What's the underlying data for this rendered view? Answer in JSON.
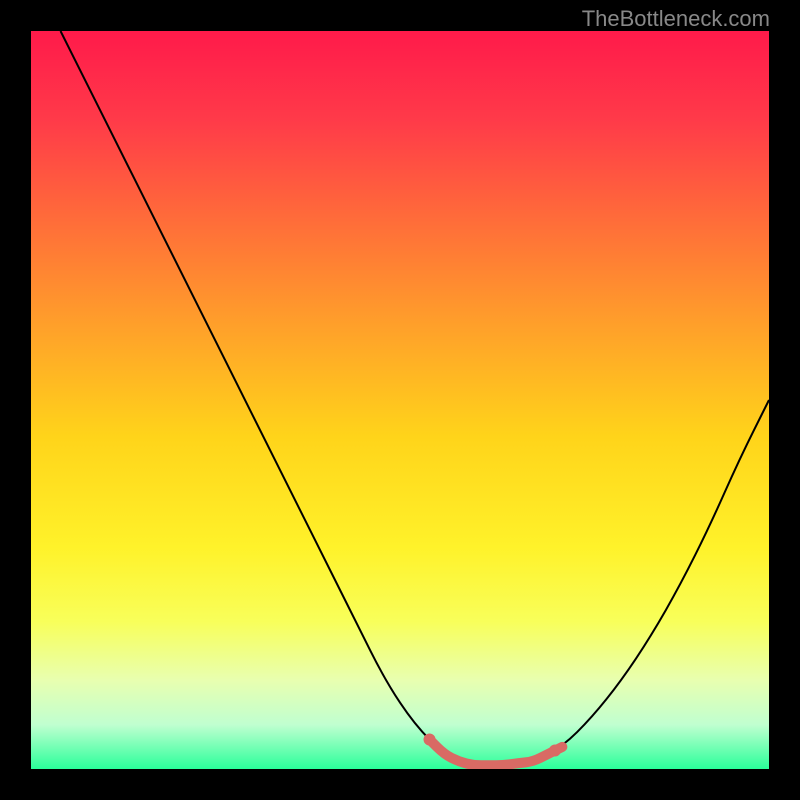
{
  "watermark": "TheBottleneck.com",
  "chart_data": {
    "type": "line",
    "title": "",
    "xlabel": "",
    "ylabel": "",
    "xlim": [
      0,
      100
    ],
    "ylim": [
      0,
      100
    ],
    "gradient_stops": [
      {
        "offset": 0,
        "color": "#ff1a4a"
      },
      {
        "offset": 12,
        "color": "#ff3a49"
      },
      {
        "offset": 25,
        "color": "#ff6a3a"
      },
      {
        "offset": 40,
        "color": "#ffa02a"
      },
      {
        "offset": 55,
        "color": "#ffd41a"
      },
      {
        "offset": 70,
        "color": "#fff22a"
      },
      {
        "offset": 80,
        "color": "#f8ff5a"
      },
      {
        "offset": 88,
        "color": "#e8ffb0"
      },
      {
        "offset": 94,
        "color": "#c0ffd0"
      },
      {
        "offset": 100,
        "color": "#2aff9a"
      }
    ],
    "series": [
      {
        "name": "bottleneck-curve",
        "color": "#000000",
        "width": 2,
        "points": [
          {
            "x": 4,
            "y": 100
          },
          {
            "x": 8,
            "y": 92
          },
          {
            "x": 12,
            "y": 84
          },
          {
            "x": 16,
            "y": 76
          },
          {
            "x": 20,
            "y": 68
          },
          {
            "x": 24,
            "y": 60
          },
          {
            "x": 28,
            "y": 52
          },
          {
            "x": 32,
            "y": 44
          },
          {
            "x": 36,
            "y": 36
          },
          {
            "x": 40,
            "y": 28
          },
          {
            "x": 44,
            "y": 20
          },
          {
            "x": 48,
            "y": 12
          },
          {
            "x": 52,
            "y": 6
          },
          {
            "x": 56,
            "y": 2
          },
          {
            "x": 60,
            "y": 0.5
          },
          {
            "x": 64,
            "y": 0.5
          },
          {
            "x": 68,
            "y": 1
          },
          {
            "x": 72,
            "y": 3
          },
          {
            "x": 76,
            "y": 7
          },
          {
            "x": 80,
            "y": 12
          },
          {
            "x": 84,
            "y": 18
          },
          {
            "x": 88,
            "y": 25
          },
          {
            "x": 92,
            "y": 33
          },
          {
            "x": 96,
            "y": 42
          },
          {
            "x": 100,
            "y": 50
          }
        ]
      },
      {
        "name": "highlight-segment",
        "color": "#d96a64",
        "width": 10,
        "linecap": "round",
        "points": [
          {
            "x": 54,
            "y": 4
          },
          {
            "x": 56,
            "y": 2
          },
          {
            "x": 58,
            "y": 1
          },
          {
            "x": 60,
            "y": 0.5
          },
          {
            "x": 62,
            "y": 0.5
          },
          {
            "x": 64,
            "y": 0.5
          },
          {
            "x": 66,
            "y": 0.8
          },
          {
            "x": 68,
            "y": 1
          },
          {
            "x": 70,
            "y": 2
          },
          {
            "x": 72,
            "y": 3
          }
        ]
      }
    ],
    "dots": [
      {
        "x": 54,
        "y": 4,
        "r": 6,
        "color": "#d96a64"
      },
      {
        "x": 71,
        "y": 2.5,
        "r": 6,
        "color": "#d96a64"
      }
    ]
  }
}
